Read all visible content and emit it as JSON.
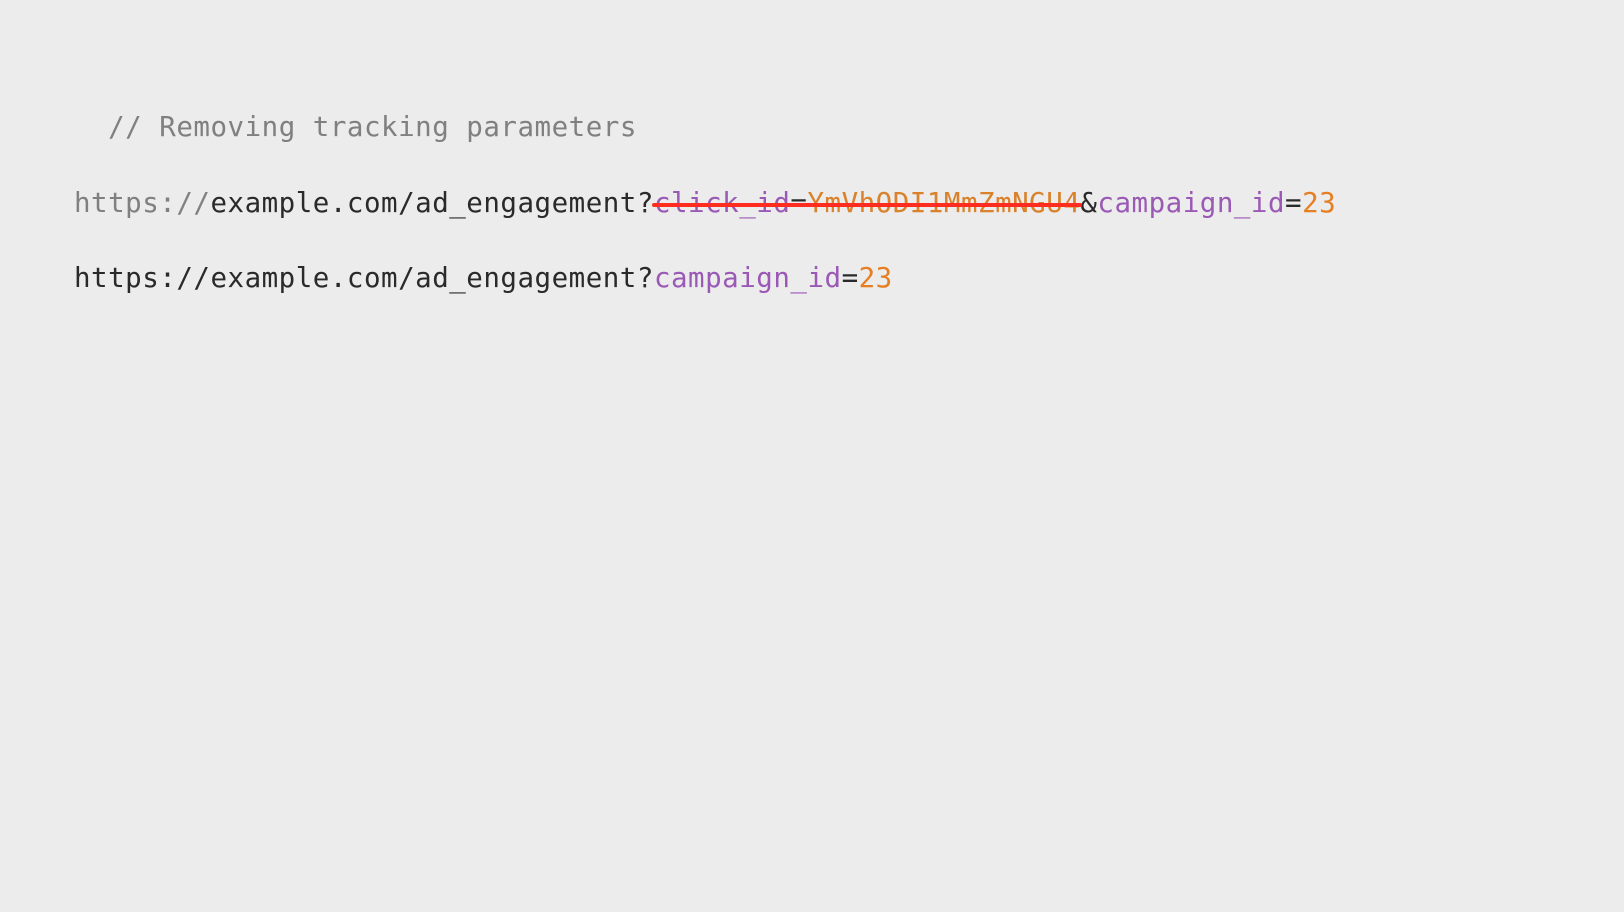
{
  "comment": "// Removing tracking parameters",
  "line1": {
    "scheme": "https://",
    "host": "example.com",
    "path": "/ad_engagement",
    "qmark": "?",
    "removed": {
      "name": "click_id",
      "eq": "=",
      "value": "YmVhODI1MmZmNGU4"
    },
    "amp": "&",
    "kept": {
      "name": "campaign_id",
      "eq": "=",
      "value": "23"
    }
  },
  "line2": {
    "scheme": "https://",
    "host": "example.com",
    "path": "/ad_engagement",
    "qmark": "?",
    "kept": {
      "name": "campaign_id",
      "eq": "=",
      "value": "23"
    }
  }
}
